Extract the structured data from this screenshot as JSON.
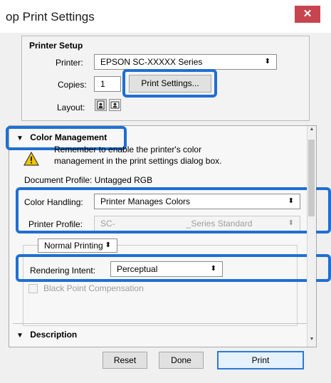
{
  "window": {
    "title": "op Print Settings",
    "close_glyph": "✕"
  },
  "printer_setup": {
    "title": "Printer Setup",
    "printer_label": "Printer:",
    "printer_value": "EPSON SC-XXXXX Series",
    "copies_label": "Copies:",
    "copies_value": "1",
    "print_settings_button": "Print Settings...",
    "layout_label": "Layout:",
    "layout_options": [
      "portrait-icon",
      "landscape-icon"
    ]
  },
  "color_management": {
    "title": "Color Management",
    "collapse_glyph": "▼",
    "warning_line1": "Remember to enable the printer's color",
    "warning_line2": "management in the print settings dialog box.",
    "document_profile": "Document Profile: Untagged RGB",
    "color_handling_label": "Color Handling:",
    "color_handling_value": "Printer Manages Colors",
    "printer_profile_label": "Printer Profile:",
    "printer_profile_value_a": "SC-",
    "printer_profile_value_b": "_Series Standard",
    "printing_mode_value": "Normal Printing",
    "rendering_intent_label": "Rendering Intent:",
    "rendering_intent_value": "Perceptual",
    "black_point_label": "Black Point Compensation"
  },
  "description": {
    "title": "Description",
    "collapse_glyph": "▼"
  },
  "footer": {
    "reset": "Reset",
    "done": "Done",
    "print": "Print"
  },
  "colors": {
    "highlight": "#1f6fd1",
    "close_button": "#c6454e",
    "warning_triangle": "#f2c500"
  }
}
